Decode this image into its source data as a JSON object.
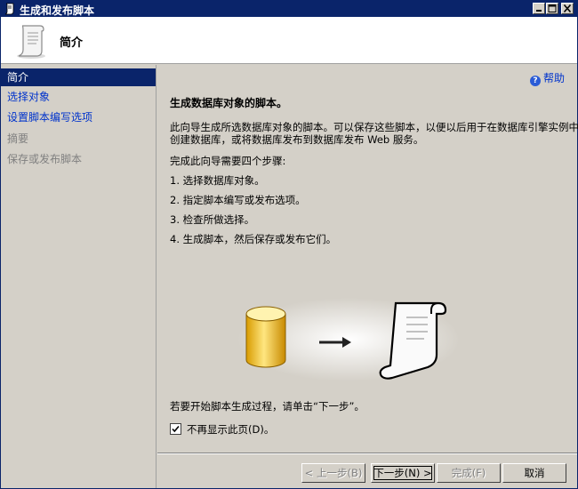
{
  "window": {
    "title": "生成和发布脚本"
  },
  "header": {
    "page_title": "简介"
  },
  "sidebar": {
    "items": [
      {
        "label": "简介",
        "state": "selected"
      },
      {
        "label": "选择对象",
        "state": "link"
      },
      {
        "label": "设置脚本编写选项",
        "state": "link"
      },
      {
        "label": "摘要",
        "state": "disabled"
      },
      {
        "label": "保存或发布脚本",
        "state": "disabled"
      }
    ]
  },
  "main": {
    "help_label": "帮助",
    "title": "生成数据库对象的脚本。",
    "intro_line1": "此向导生成所选数据库对象的脚本。可以保存这些脚本，以便以后用于在数据库引擎实例中",
    "intro_line2": "创建数据库，或将数据库发布到数据库发布 Web 服务。",
    "steps_heading": "完成此向导需要四个步骤:",
    "steps": [
      "1.  选择数据库对象。",
      "2.  指定脚本编写或发布选项。",
      "3.  检查所做选择。",
      "4.  生成脚本，然后保存或发布它们。"
    ],
    "start_hint": "若要开始脚本生成过程，请单击“下一步”。",
    "checkbox_label": "不再显示此页(D)。",
    "checkbox_checked": true,
    "illustration_icons": [
      "database-icon",
      "arrow-right-icon",
      "script-scroll-icon"
    ]
  },
  "buttons": {
    "back": "< 上一步(B)",
    "next": "下一步(N) >",
    "finish": "完成(F)",
    "cancel": "取消"
  },
  "colors": {
    "titlebar": "#0a246a",
    "selection": "#0a246a",
    "link": "#0033cc",
    "face": "#d4d0c8"
  }
}
